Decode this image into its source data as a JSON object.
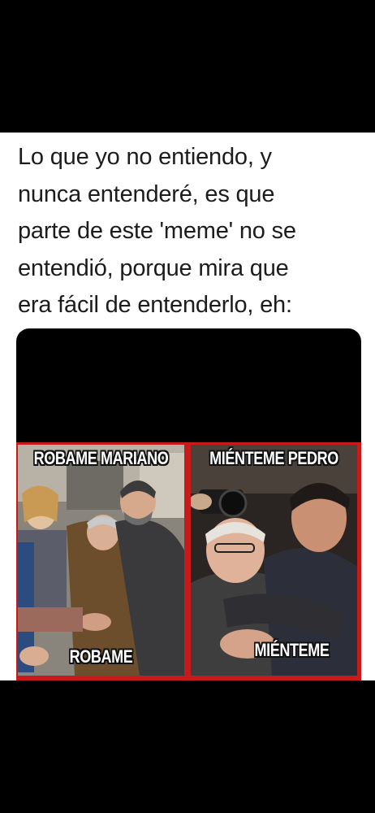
{
  "post": {
    "text_lines": [
      "Lo que yo no entiendo, y",
      "nunca entenderé, es que",
      "parte de este 'meme' no se",
      "entendió, porque mira que",
      "era fácil de entenderlo, eh:"
    ]
  },
  "meme": {
    "left_panel": {
      "top_caption": "ROBAME MARIANO",
      "bottom_caption": "ROBAME"
    },
    "right_panel": {
      "top_caption": "MIÉNTEME PEDRO",
      "bottom_caption": "MIÉNTEME"
    },
    "border_color": "#c8191b"
  }
}
